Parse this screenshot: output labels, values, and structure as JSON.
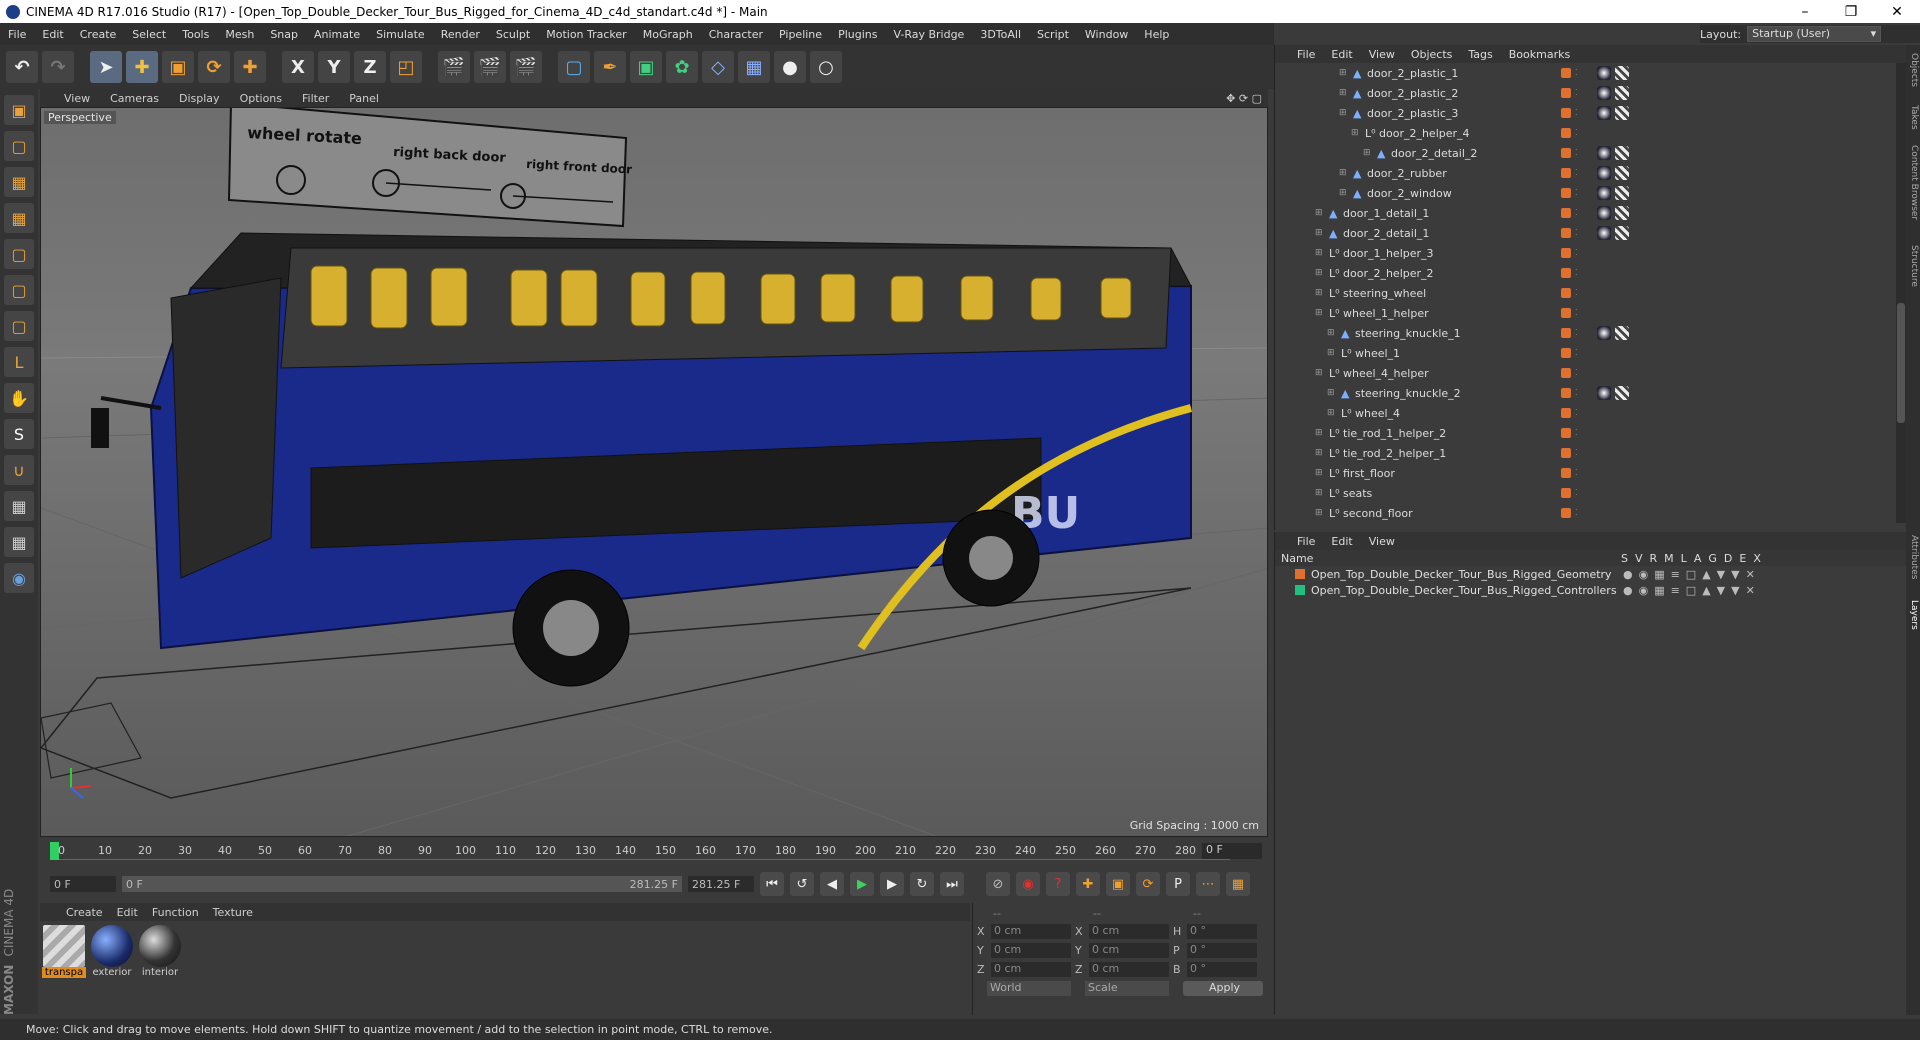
{
  "window": {
    "title": "CINEMA 4D R17.016 Studio (R17) - [Open_Top_Double_Decker_Tour_Bus_Rigged_for_Cinema_4D_c4d_standart.c4d *] - Main"
  },
  "menu": [
    "File",
    "Edit",
    "Create",
    "Select",
    "Tools",
    "Mesh",
    "Snap",
    "Animate",
    "Simulate",
    "Render",
    "Sculpt",
    "Motion Tracker",
    "MoGraph",
    "Character",
    "Pipeline",
    "Plugins",
    "V-Ray Bridge",
    "3DToAll",
    "Script",
    "Window",
    "Help"
  ],
  "layout": {
    "label": "Layout:",
    "value": "Startup (User)"
  },
  "viewport": {
    "menu": [
      "View",
      "Cameras",
      "Display",
      "Options",
      "Filter",
      "Panel"
    ],
    "label": "Perspective",
    "grid_spacing": "Grid Spacing : 1000 cm",
    "sign": {
      "wheel": "wheel rotate",
      "back": "right back door",
      "front": "right front door"
    }
  },
  "timeline": {
    "ticks": [
      "0",
      "10",
      "20",
      "30",
      "40",
      "50",
      "60",
      "70",
      "80",
      "90",
      "100",
      "110",
      "120",
      "130",
      "140",
      "150",
      "160",
      "170",
      "180",
      "190",
      "200",
      "210",
      "220",
      "230",
      "240",
      "250",
      "260",
      "270",
      "280"
    ],
    "current": "0 F",
    "start": "0 F",
    "min": "0 F",
    "max": "281.25 F",
    "end": "281.25 F"
  },
  "materials": {
    "menu": [
      "Create",
      "Edit",
      "Function",
      "Texture"
    ],
    "items": [
      {
        "label": "transpa",
        "color": "#cfcfcf"
      },
      {
        "label": "exterior",
        "color": "#2a3b7a"
      },
      {
        "label": "interior",
        "color": "#2a2a2a"
      }
    ]
  },
  "coords": {
    "x": "0 cm",
    "y": "0 cm",
    "z": "0 cm",
    "sx": "0 cm",
    "sy": "0 cm",
    "sz": "0 cm",
    "h": "0 °",
    "p": "0 °",
    "b": "0 °",
    "mode1": "World",
    "mode2": "Scale",
    "apply": "Apply",
    "col1": "--",
    "col2": "--",
    "col3": "--"
  },
  "objects": {
    "menu": [
      "File",
      "Edit",
      "View",
      "Objects",
      "Tags",
      "Bookmarks"
    ],
    "rows": [
      {
        "name": "door_2_plastic_1",
        "indent": 3,
        "icon": "triangle"
      },
      {
        "name": "door_2_plastic_2",
        "indent": 3,
        "icon": "triangle"
      },
      {
        "name": "door_2_plastic_3",
        "indent": 3,
        "icon": "triangle"
      },
      {
        "name": "door_2_helper_4",
        "indent": 4,
        "icon": "null"
      },
      {
        "name": "door_2_detail_2",
        "indent": 5,
        "icon": "triangle"
      },
      {
        "name": "door_2_rubber",
        "indent": 3,
        "icon": "triangle"
      },
      {
        "name": "door_2_window",
        "indent": 3,
        "icon": "triangle"
      },
      {
        "name": "door_1_detail_1",
        "indent": 1,
        "icon": "triangle"
      },
      {
        "name": "door_2_detail_1",
        "indent": 1,
        "icon": "triangle"
      },
      {
        "name": "door_1_helper_3",
        "indent": 1,
        "icon": "null"
      },
      {
        "name": "door_2_helper_2",
        "indent": 1,
        "icon": "null"
      },
      {
        "name": "steering_wheel",
        "indent": 1,
        "icon": "null"
      },
      {
        "name": "wheel_1_helper",
        "indent": 1,
        "icon": "null"
      },
      {
        "name": "steering_knuckle_1",
        "indent": 2,
        "icon": "triangle"
      },
      {
        "name": "wheel_1",
        "indent": 2,
        "icon": "null"
      },
      {
        "name": "wheel_4_helper",
        "indent": 1,
        "icon": "null"
      },
      {
        "name": "steering_knuckle_2",
        "indent": 2,
        "icon": "triangle"
      },
      {
        "name": "wheel_4",
        "indent": 2,
        "icon": "null"
      },
      {
        "name": "tie_rod_1_helper_2",
        "indent": 1,
        "icon": "null"
      },
      {
        "name": "tie_rod_2_helper_1",
        "indent": 1,
        "icon": "null"
      },
      {
        "name": "first_floor",
        "indent": 1,
        "icon": "null"
      },
      {
        "name": "seats",
        "indent": 1,
        "icon": "null"
      },
      {
        "name": "second_floor",
        "indent": 1,
        "icon": "null"
      }
    ]
  },
  "layers": {
    "menu": [
      "File",
      "Edit",
      "View"
    ],
    "header": {
      "name": "Name",
      "cols": [
        "S",
        "V",
        "R",
        "M",
        "L",
        "A",
        "G",
        "D",
        "E",
        "X"
      ]
    },
    "rows": [
      {
        "name": "Open_Top_Double_Decker_Tour_Bus_Rigged_Geometry",
        "color": "#e07030"
      },
      {
        "name": "Open_Top_Double_Decker_Tour_Bus_Rigged_Controllers",
        "color": "#20c080"
      }
    ]
  },
  "status": "Move: Click and drag to move elements. Hold down SHIFT to quantize movement / add to the selection in point mode, CTRL to remove.",
  "brand": {
    "line1": "MAXON",
    "line2": "CINEMA 4D"
  },
  "side_tabs": [
    "Objects",
    "Takes",
    "Content Browser",
    "Structure",
    "Attributes",
    "Layers"
  ]
}
